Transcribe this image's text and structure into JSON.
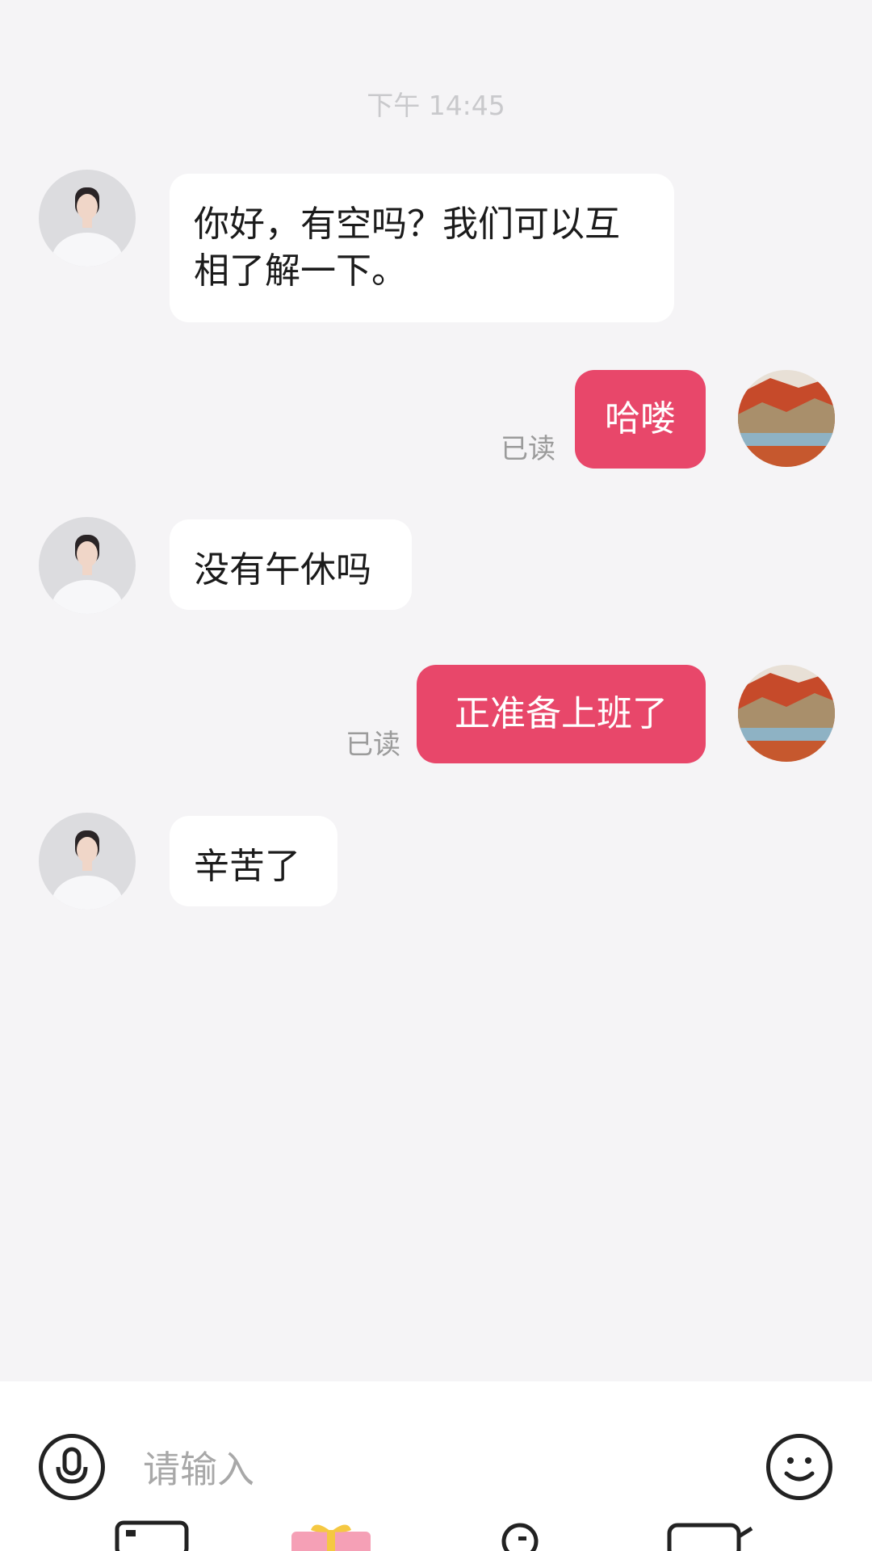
{
  "timestamp": "下午 14:45",
  "messages": [
    {
      "side": "in",
      "text": "你好，有空吗？我们可以互相了解一下。"
    },
    {
      "side": "out",
      "text": "哈喽",
      "status": "已读"
    },
    {
      "side": "in",
      "text": "没有午休吗"
    },
    {
      "side": "out",
      "text": "正准备上班了",
      "status": "已读"
    },
    {
      "side": "in",
      "text": "辛苦了"
    }
  ],
  "input": {
    "placeholder": "请输入"
  },
  "colors": {
    "accent": "#e8476a",
    "background": "#f5f4f6"
  },
  "icons": {
    "voice": "microphone-icon",
    "emoji": "smiley-icon",
    "toolbar": [
      "image-icon",
      "gift-icon",
      "location-icon",
      "video-icon"
    ]
  }
}
